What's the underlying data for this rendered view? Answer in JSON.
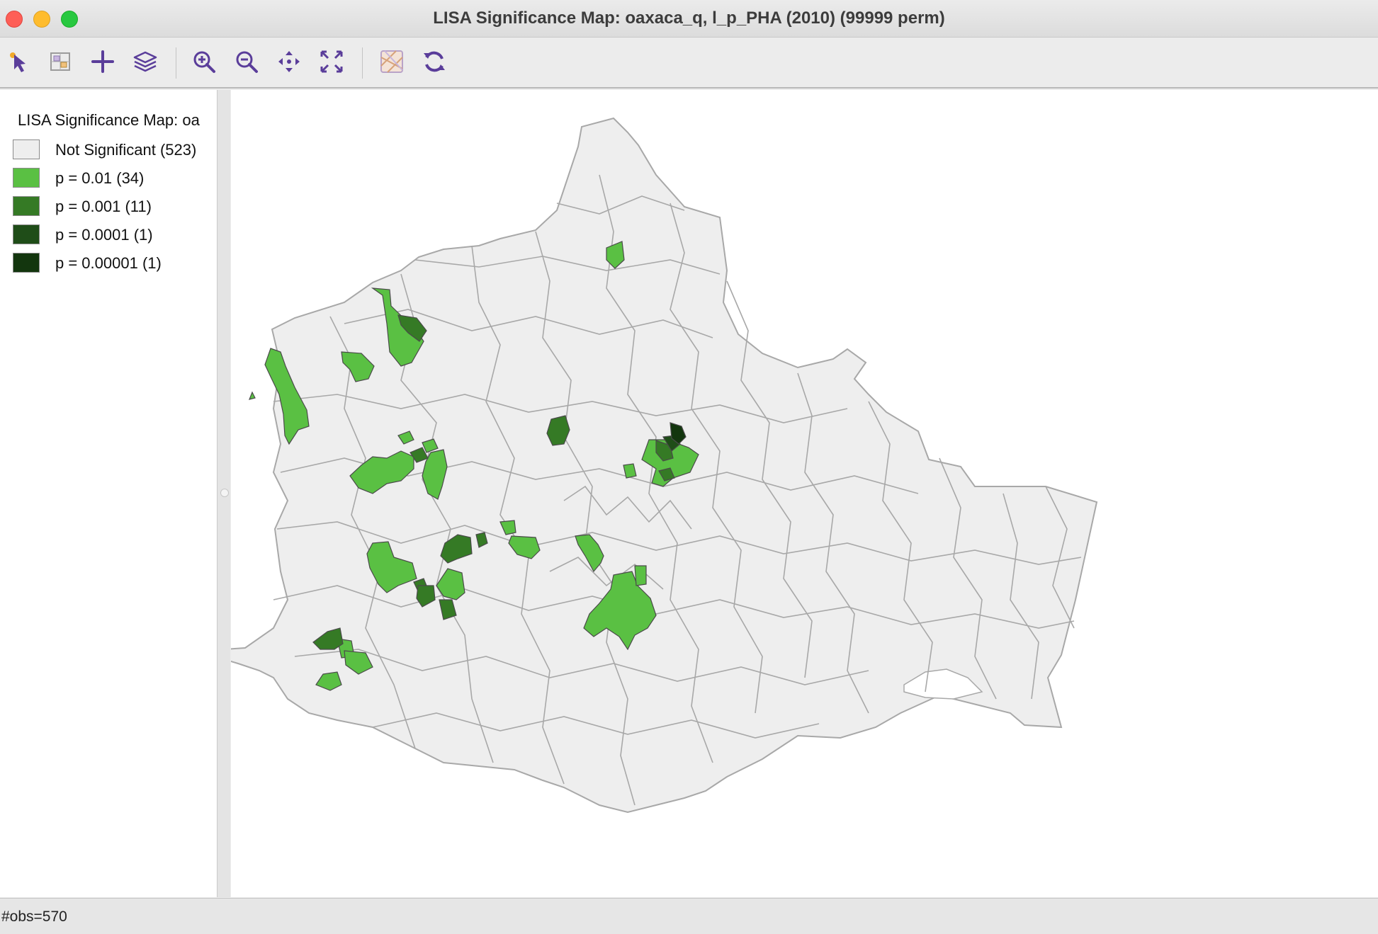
{
  "window": {
    "title": "LISA Significance Map: oaxaca_q, l_p_PHA (2010) (99999 perm)"
  },
  "toolbar": {
    "buttons": [
      {
        "id": "select",
        "icon": "pointer-select-icon"
      },
      {
        "id": "table-select",
        "icon": "selection-table-icon"
      },
      {
        "id": "add",
        "icon": "plus-icon"
      },
      {
        "id": "layers",
        "icon": "layers-icon"
      },
      {
        "id": "zoom-in",
        "icon": "zoom-in-icon"
      },
      {
        "id": "zoom-out",
        "icon": "zoom-out-icon"
      },
      {
        "id": "pan",
        "icon": "pan-icon"
      },
      {
        "id": "full-extent",
        "icon": "full-extent-icon"
      },
      {
        "id": "basemap",
        "icon": "basemap-icon"
      },
      {
        "id": "refresh",
        "icon": "refresh-icon"
      }
    ]
  },
  "legend": {
    "title": "LISA Significance Map: oa",
    "items": [
      {
        "label": "Not Significant (523)",
        "color": "#eeeeee"
      },
      {
        "label": "p = 0.01 (34)",
        "color": "#5ac043"
      },
      {
        "label": "p = 0.001 (11)",
        "color": "#357a25"
      },
      {
        "label": "p = 0.0001 (1)",
        "color": "#1f4d18"
      },
      {
        "label": "p = 0.00001 (1)",
        "color": "#13360e"
      }
    ]
  },
  "map": {
    "colors": {
      "background": "#eeeeee",
      "boundary": "#a8a8a8",
      "p01": "#5ac043",
      "p001": "#357a25",
      "p0001": "#1f4d18",
      "p00001": "#13360e"
    }
  },
  "status": {
    "text": "#obs=570"
  }
}
